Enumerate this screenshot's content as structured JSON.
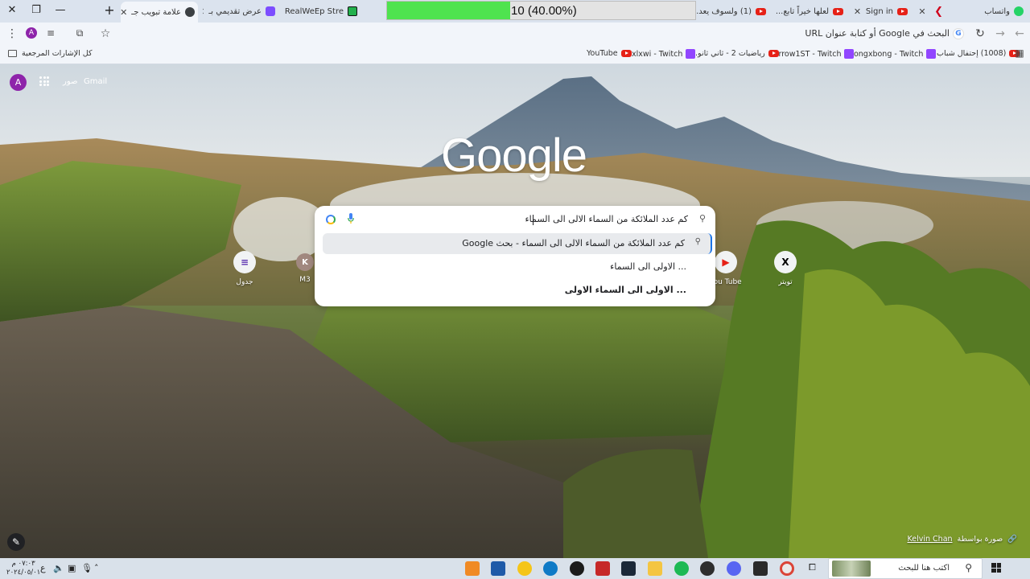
{
  "tabs": [
    {
      "title": "واتساب",
      "icon": "whatsapp-icon"
    },
    {
      "title": "",
      "icon": "chevron-icon"
    },
    {
      "title": "Sign in",
      "icon": "youtube-icon"
    },
    {
      "title": "لعلها خيراً تابع...",
      "icon": "youtube-icon"
    },
    {
      "title": "(1) ولسوف يعد...",
      "icon": "youtube-icon"
    },
    {
      "title": "عرض تقديمي بـ",
      "icon": "slides-icon"
    },
    {
      "title": "RealWeEp Stre",
      "icon": "green-icon"
    },
    {
      "title": "علامة تبويب جـ",
      "icon": "globe-icon"
    }
  ],
  "progress": {
    "label": "10 (40.00%)",
    "fraction": 0.4
  },
  "toolbar": {
    "omnibox_placeholder": "البحث في Google أو كتابة عنوان URL",
    "google_badge": "G",
    "avatar_letter": "A"
  },
  "bookmarks": {
    "all_label": "كل الإشارات المرجعية",
    "items": [
      {
        "label": "(1008) إحتفال شباب...",
        "icon": "youtube-icon"
      },
      {
        "label": "shongxbong - Twitch",
        "icon": "twitch-icon"
      },
      {
        "label": "Arrow1ST - Twitch",
        "icon": "twitch-icon"
      },
      {
        "label": "رياضيات 2 - ثاني ثانو...",
        "icon": "youtube-icon"
      },
      {
        "label": "xlxwi - Twitch",
        "icon": "twitch-icon"
      },
      {
        "label": "YouTube",
        "icon": "youtube-icon"
      }
    ]
  },
  "ntp": {
    "gmail_label": "Gmail",
    "images_label": "صور",
    "avatar_letter": "A",
    "logo_text": "Google",
    "search": {
      "query": "كم عدد الملائكة من السماء الالى الى السماء",
      "suggestions": [
        {
          "text": "كم عدد الملائكة من السماء الالى الى السماء - بحث Google",
          "highlighted": true
        },
        {
          "text": "... الاولى الى السماء",
          "highlighted": false
        },
        {
          "text": "... الاولى الى السماء الاولى",
          "highlighted": false
        }
      ]
    },
    "shortcuts": [
      {
        "label": "جدول",
        "letter": "≡"
      },
      {
        "label": "M3",
        "letter": "K"
      },
      {
        "label": "You Tube",
        "letter": "▶"
      },
      {
        "label": "تويتر",
        "letter": "X"
      }
    ],
    "credit_prefix": "صورة بواسطة",
    "credit_author": "Kelvin Chan"
  },
  "taskbar": {
    "time": "٠٧:٠٣ م",
    "date": "٢٠٢٤/٠٥/٠١",
    "lang": "ع",
    "search_placeholder": "اكتب هنا للبحث"
  },
  "colors": {
    "accent": "#1a73e8",
    "progress_fill": "#4fe34f",
    "youtube_red": "#e62117",
    "twitch_purple": "#9146ff",
    "avatar_purple": "#8e24aa"
  }
}
